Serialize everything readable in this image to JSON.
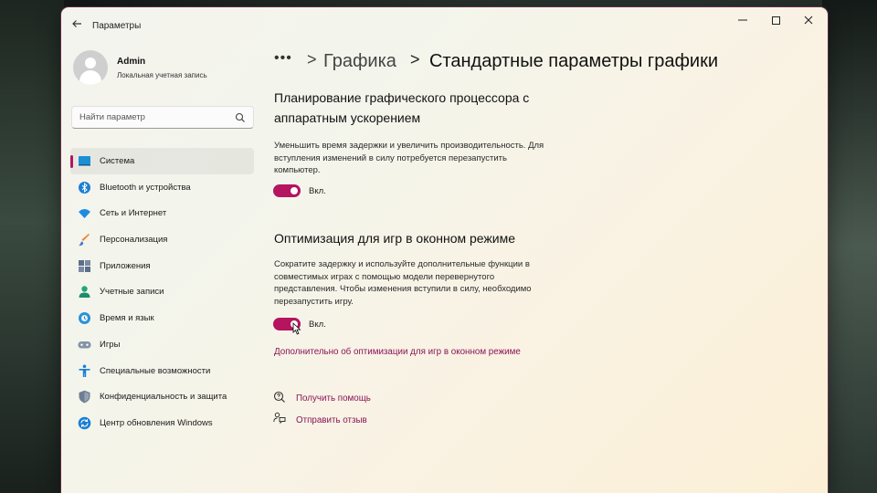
{
  "window": {
    "title": "Параметры"
  },
  "user": {
    "name": "Admin",
    "account_type": "Локальная учетная запись"
  },
  "search": {
    "placeholder": "Найти параметр"
  },
  "sidebar": {
    "items": [
      {
        "label": "Система",
        "icon": "system-icon",
        "active": true
      },
      {
        "label": "Bluetooth и устройства",
        "icon": "bluetooth-icon"
      },
      {
        "label": "Сеть и Интернет",
        "icon": "wifi-icon"
      },
      {
        "label": "Персонализация",
        "icon": "brush-icon"
      },
      {
        "label": "Приложения",
        "icon": "apps-icon"
      },
      {
        "label": "Учетные записи",
        "icon": "accounts-icon"
      },
      {
        "label": "Время и язык",
        "icon": "time-language-icon"
      },
      {
        "label": "Игры",
        "icon": "gamepad-icon"
      },
      {
        "label": "Специальные возможности",
        "icon": "accessibility-icon"
      },
      {
        "label": "Конфиденциальность и защита",
        "icon": "shield-icon"
      },
      {
        "label": "Центр обновления Windows",
        "icon": "update-icon"
      }
    ]
  },
  "breadcrumb": {
    "more": "•••",
    "separator": ">",
    "parent": "Графика",
    "current": "Стандартные параметры графики"
  },
  "settings": {
    "hags": {
      "title_line1": "Планирование графического процессора с",
      "title_line2": "аппаратным ускорением",
      "desc_line1": "Уменьшить время задержки и увеличить производительность. Для",
      "desc_line2": "вступления изменений в силу потребуется перезапустить",
      "desc_line3": "компьютер.",
      "toggle_state": "Вкл.",
      "enabled": true
    },
    "windowed": {
      "title": "Оптимизация для игр в оконном режиме",
      "desc_line1": "Сократите задержку и используйте дополнительные функции в",
      "desc_line2": "совместимых играх с помощью модели перевернутого",
      "desc_line3": "представления. Чтобы изменения вступили в силу, необходимо",
      "desc_line4": "перезапустить игру.",
      "toggle_state": "Вкл.",
      "enabled": true,
      "learn_more": "Дополнительно об оптимизации для игр в оконном режиме"
    }
  },
  "footer": {
    "help": "Получить помощь",
    "feedback": "Отправить отзыв"
  },
  "colors": {
    "accent": "#b5145f",
    "link": "#8a1458"
  }
}
